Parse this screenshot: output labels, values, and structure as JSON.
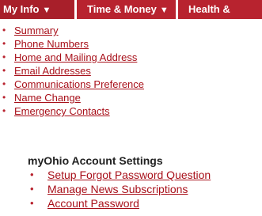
{
  "nav": {
    "tabs": [
      {
        "label": "My Info",
        "arrow": "▼"
      },
      {
        "label": "Time & Money",
        "arrow": "▼"
      },
      {
        "label": "Health &",
        "arrow": ""
      }
    ]
  },
  "menu": {
    "bullet": "•",
    "items": [
      {
        "label": "Summary"
      },
      {
        "label": "Phone Numbers"
      },
      {
        "label": "Home and Mailing Address"
      },
      {
        "label": "Email Addresses"
      },
      {
        "label": "Communications Preference"
      },
      {
        "label": "Name Change"
      },
      {
        "label": "Emergency Contacts"
      }
    ]
  },
  "account_settings": {
    "heading": "myOhio Account Settings",
    "items": [
      {
        "label": "Setup Forgot Password Question"
      },
      {
        "label": "Manage News Subscriptions"
      },
      {
        "label": "Account Password"
      }
    ]
  },
  "colors": {
    "nav_bg": "#b8232f",
    "link": "#a8101a"
  }
}
